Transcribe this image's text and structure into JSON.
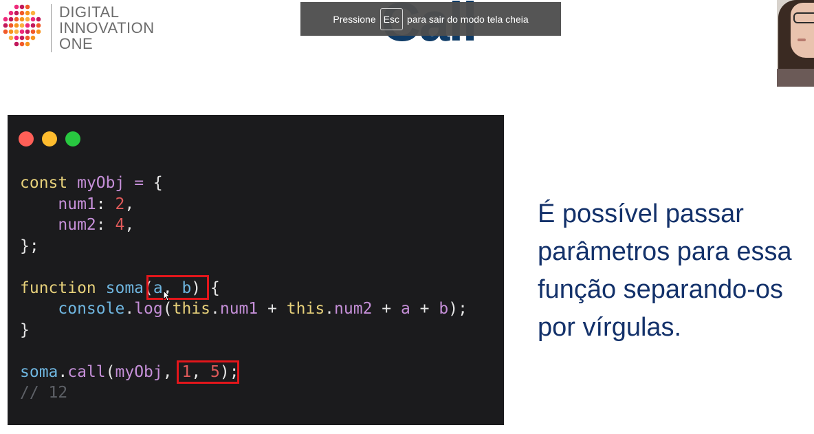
{
  "logo": {
    "lines": [
      "DIGITAL",
      "INNOVATION",
      "ONE"
    ],
    "dot_colors": [
      "#f15a29",
      "#f7941d",
      "#fbb040",
      "#ee2a7b",
      "#c2185b"
    ]
  },
  "slide": {
    "title": "Call"
  },
  "fullscreen_toast": {
    "before": "Pressione",
    "key": "Esc",
    "after": "para sair do modo tela cheia"
  },
  "webcam": {
    "icon": "webcam-person"
  },
  "code_window": {
    "window_buttons": [
      "close",
      "minimize",
      "maximize"
    ],
    "lines": [
      [
        [
          "kw",
          "const "
        ],
        [
          "var",
          "myObj "
        ],
        [
          "op",
          "= "
        ],
        [
          "punc",
          "{"
        ]
      ],
      [
        [
          "punc",
          "    "
        ],
        [
          "var",
          "num1"
        ],
        [
          "punc",
          ": "
        ],
        [
          "num",
          "2"
        ],
        [
          "punc",
          ","
        ]
      ],
      [
        [
          "punc",
          "    "
        ],
        [
          "var",
          "num2"
        ],
        [
          "punc",
          ": "
        ],
        [
          "num",
          "4"
        ],
        [
          "punc",
          ","
        ]
      ],
      [
        [
          "punc",
          "};"
        ]
      ],
      [],
      [
        [
          "kw",
          "function "
        ],
        [
          "fn",
          "soma"
        ],
        [
          "punc",
          "("
        ],
        [
          "fn",
          "a"
        ],
        [
          "punc",
          ", "
        ],
        [
          "fn",
          "b"
        ],
        [
          "punc",
          ") {"
        ]
      ],
      [
        [
          "punc",
          "    "
        ],
        [
          "fn",
          "console"
        ],
        [
          "punc",
          "."
        ],
        [
          "var",
          "log"
        ],
        [
          "punc",
          "("
        ],
        [
          "kw",
          "this"
        ],
        [
          "punc",
          "."
        ],
        [
          "var",
          "num1"
        ],
        [
          "punc",
          " + "
        ],
        [
          "kw",
          "this"
        ],
        [
          "punc",
          "."
        ],
        [
          "var",
          "num2"
        ],
        [
          "punc",
          " + "
        ],
        [
          "var",
          "a"
        ],
        [
          "punc",
          " + "
        ],
        [
          "var",
          "b"
        ],
        [
          "punc",
          ");"
        ]
      ],
      [
        [
          "punc",
          "}"
        ]
      ],
      [],
      [
        [
          "fn",
          "soma"
        ],
        [
          "punc",
          "."
        ],
        [
          "var",
          "call"
        ],
        [
          "punc",
          "("
        ],
        [
          "var",
          "myObj"
        ],
        [
          "punc",
          ", "
        ],
        [
          "num",
          "1"
        ],
        [
          "punc",
          ", "
        ],
        [
          "num",
          "5"
        ],
        [
          "punc",
          ");"
        ]
      ],
      [
        [
          "cmt",
          "// 12"
        ]
      ]
    ],
    "highlight_color": "#e3161b",
    "colors": {
      "background": "#1b1b1d",
      "keyword": "#e6d07a",
      "function": "#6fb6e0",
      "variable": "#c58fd8",
      "number": "#e05a5a",
      "comment": "#5d6066"
    }
  },
  "description": {
    "text": "É possível passar parâmetros para essa função separando-os por vírgulas.",
    "lines": [
      "É possível passar",
      "parâmetros para essa",
      "função separando-os",
      "por vírgulas."
    ],
    "color": "#13316a"
  }
}
